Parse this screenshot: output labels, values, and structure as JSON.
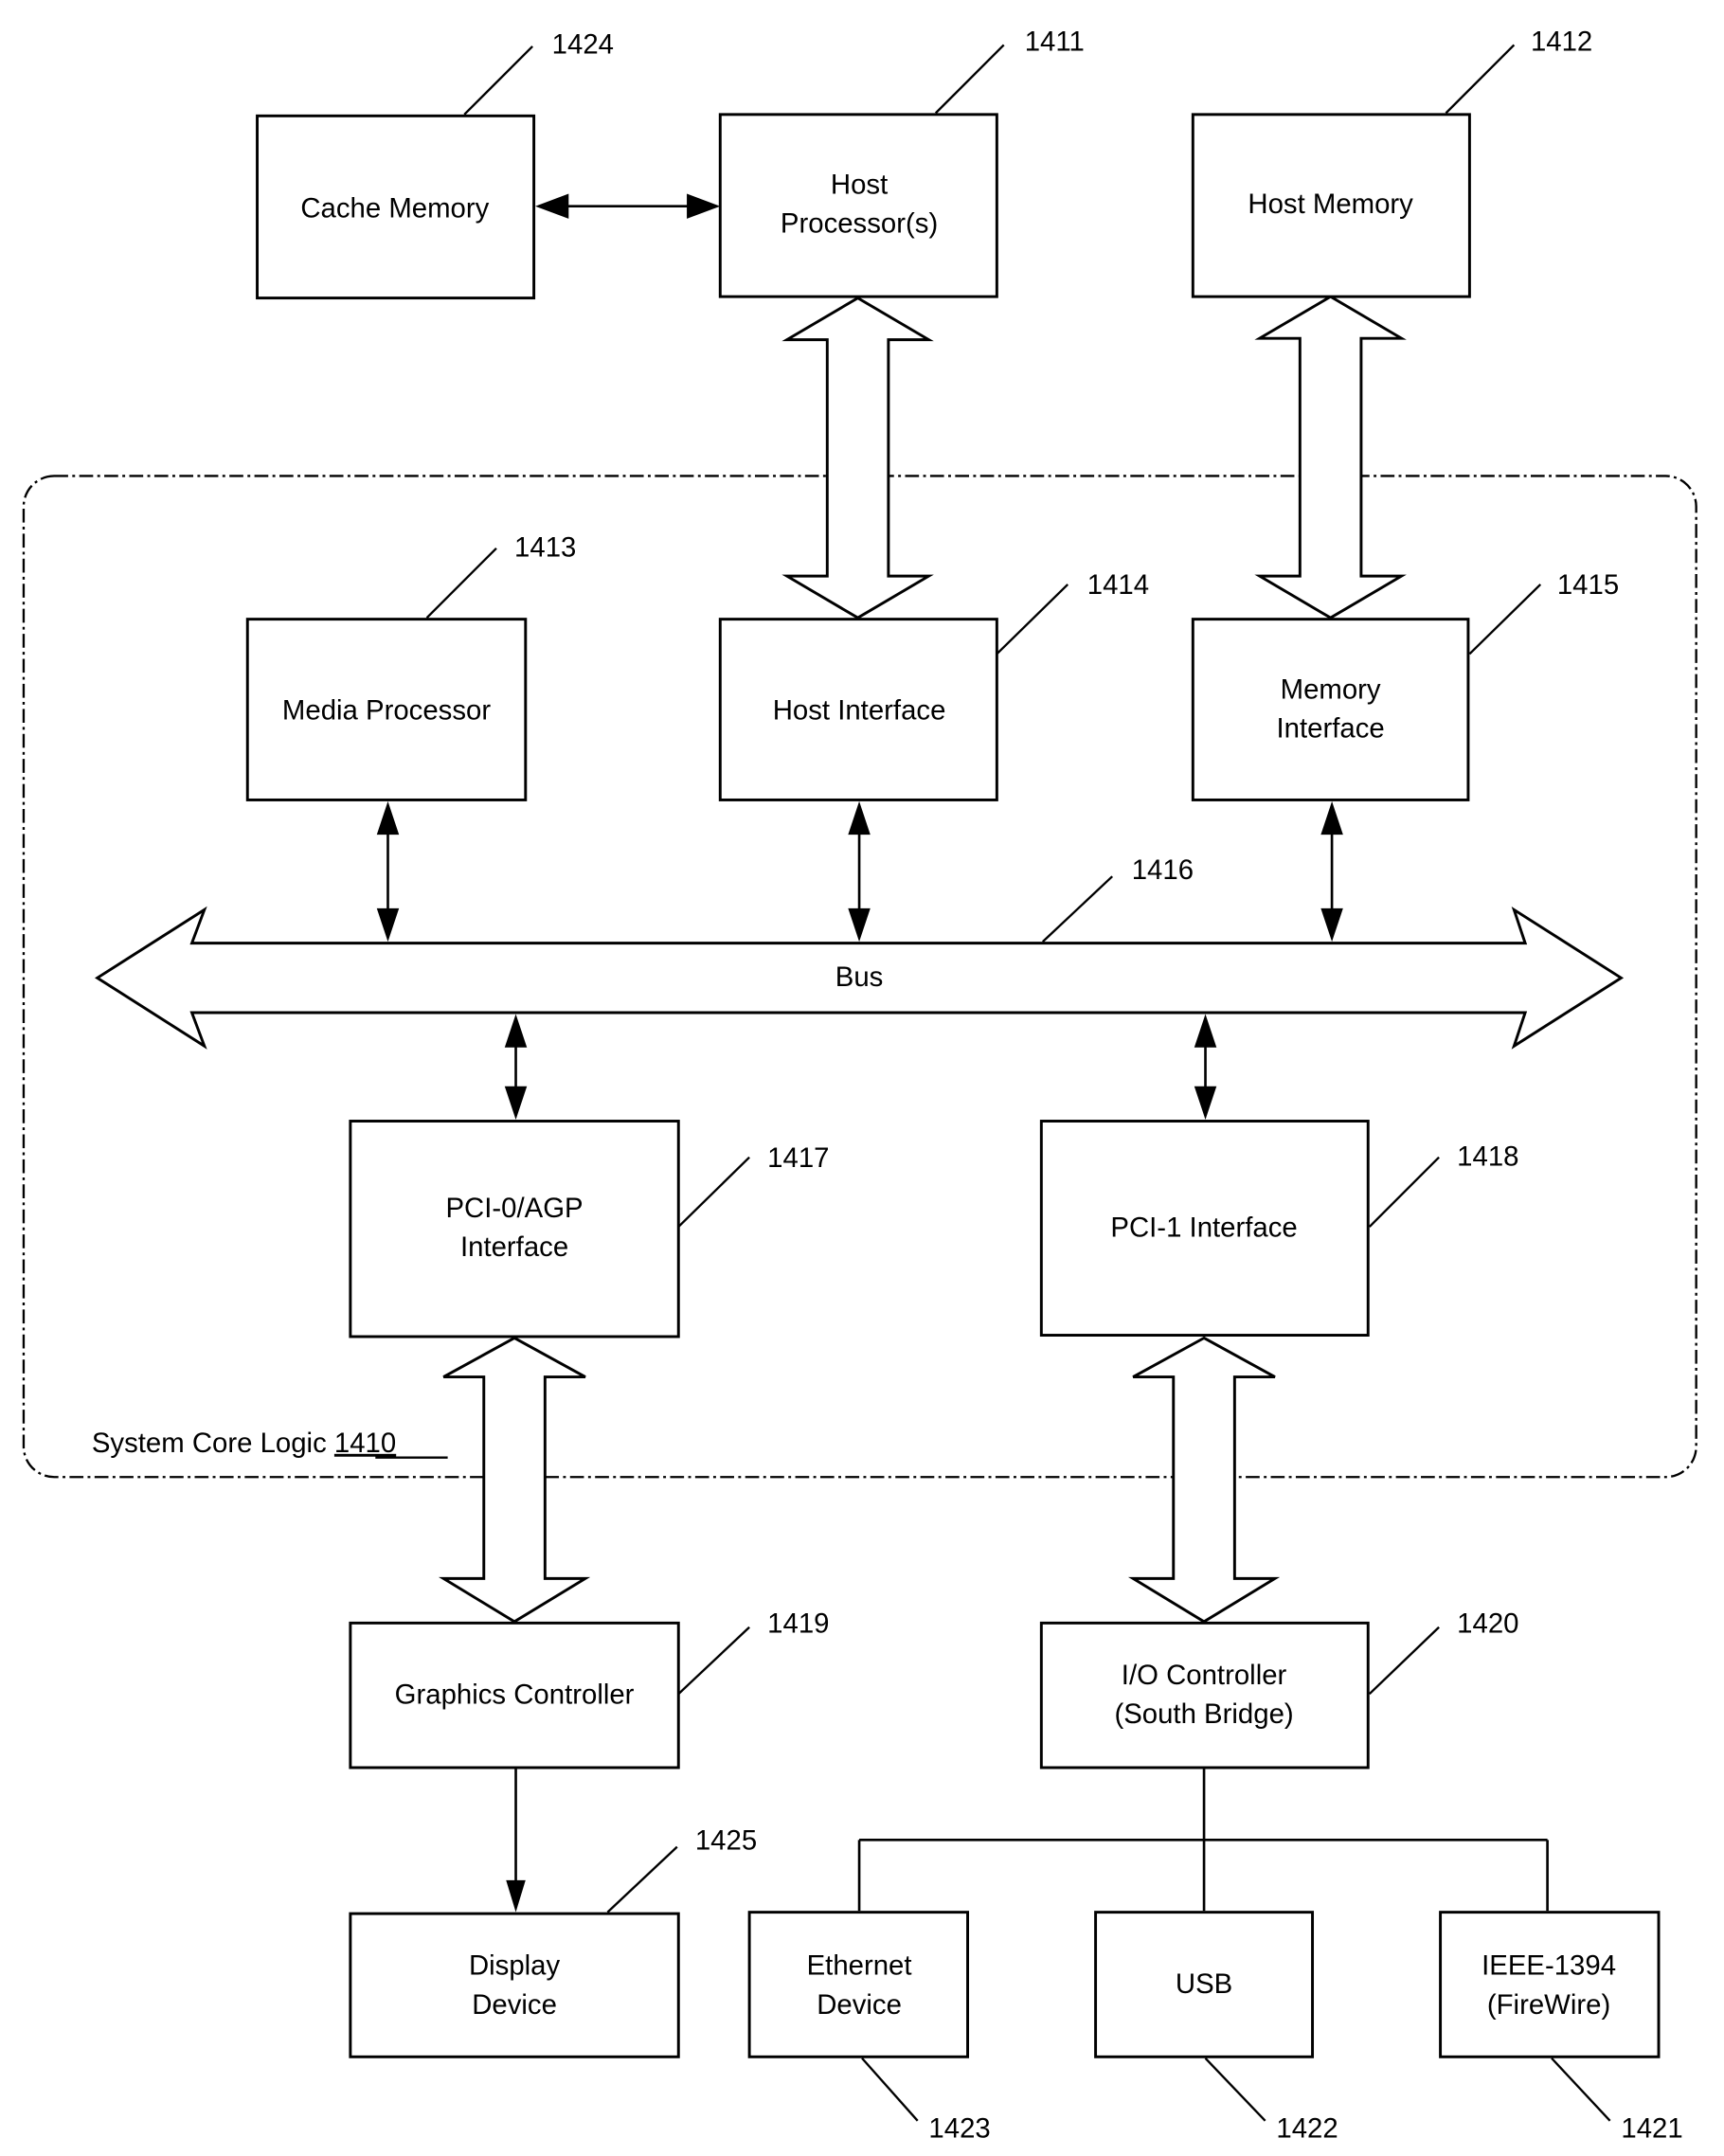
{
  "diagram": {
    "type": "block-diagram",
    "boundary": {
      "label": "System Core Logic",
      "ref": "1410"
    },
    "bus": {
      "label": "Bus",
      "ref": "1416"
    },
    "blocks": {
      "cache_memory": {
        "lines": [
          "Cache Memory"
        ],
        "ref": "1424"
      },
      "host_processor": {
        "lines": [
          "Host",
          "Processor(s)"
        ],
        "ref": "1411"
      },
      "host_memory": {
        "lines": [
          "Host Memory"
        ],
        "ref": "1412"
      },
      "media_processor": {
        "lines": [
          "Media Processor"
        ],
        "ref": "1413"
      },
      "host_interface": {
        "lines": [
          "Host Interface"
        ],
        "ref": "1414"
      },
      "memory_interface": {
        "lines": [
          "Memory",
          "Interface"
        ],
        "ref": "1415"
      },
      "pci0_agp_interface": {
        "lines": [
          "PCI-0/AGP",
          "Interface"
        ],
        "ref": "1417"
      },
      "pci1_interface": {
        "lines": [
          "PCI-1 Interface"
        ],
        "ref": "1418"
      },
      "graphics_controller": {
        "lines": [
          "Graphics Controller"
        ],
        "ref": "1419"
      },
      "io_controller": {
        "lines": [
          "I/O Controller",
          "(South Bridge)"
        ],
        "ref": "1420"
      },
      "ieee1394": {
        "lines": [
          "IEEE-1394",
          "(FireWire)"
        ],
        "ref": "1421"
      },
      "usb": {
        "lines": [
          "USB"
        ],
        "ref": "1422"
      },
      "ethernet_device": {
        "lines": [
          "Ethernet",
          "Device"
        ],
        "ref": "1423"
      },
      "display_device": {
        "lines": [
          "Display",
          "Device"
        ],
        "ref": "1425"
      }
    },
    "connections": [
      {
        "from": "cache_memory",
        "to": "host_processor",
        "kind": "bidirectional-arrow"
      },
      {
        "from": "host_processor",
        "to": "host_interface",
        "kind": "wide-bidirectional"
      },
      {
        "from": "host_memory",
        "to": "memory_interface",
        "kind": "wide-bidirectional"
      },
      {
        "from": "media_processor",
        "to": "bus",
        "kind": "bidirectional-arrow"
      },
      {
        "from": "host_interface",
        "to": "bus",
        "kind": "bidirectional-arrow"
      },
      {
        "from": "memory_interface",
        "to": "bus",
        "kind": "bidirectional-arrow"
      },
      {
        "from": "bus",
        "to": "pci0_agp_interface",
        "kind": "bidirectional-arrow"
      },
      {
        "from": "bus",
        "to": "pci1_interface",
        "kind": "bidirectional-arrow"
      },
      {
        "from": "pci0_agp_interface",
        "to": "graphics_controller",
        "kind": "wide-bidirectional"
      },
      {
        "from": "pci1_interface",
        "to": "io_controller",
        "kind": "wide-bidirectional"
      },
      {
        "from": "graphics_controller",
        "to": "display_device",
        "kind": "arrow"
      },
      {
        "from": "io_controller",
        "to": "ethernet_device",
        "kind": "line"
      },
      {
        "from": "io_controller",
        "to": "usb",
        "kind": "line"
      },
      {
        "from": "io_controller",
        "to": "ieee1394",
        "kind": "line"
      }
    ]
  }
}
